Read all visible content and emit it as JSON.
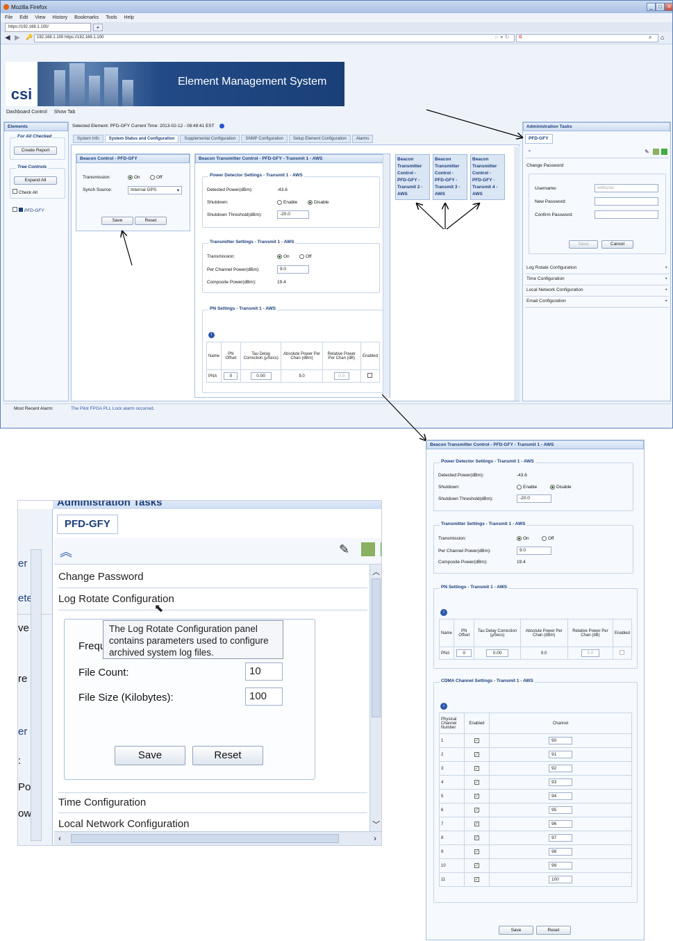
{
  "browser": {
    "title": "Mozilla Firefox",
    "menu": [
      "File",
      "Edit",
      "View",
      "History",
      "Bookmarks",
      "Tools",
      "Help"
    ],
    "tab_label": "https://192.168.1.100/",
    "new_tab": "+",
    "url": "192.168.1.100   https://192.168.1.100",
    "search_engine": "G"
  },
  "app": {
    "banner_title": "Element Management System",
    "logo": "csi",
    "toolbar": [
      "Dashboard Control",
      "Show Tab"
    ],
    "selected_element": "Selected Element:  PFD-GFY   Current Time: 2013-02-12 - 08:49:41 EST",
    "recent_alarm_label": "Most Recent Alarm:",
    "recent_alarm_text": "The Pilot FPGA PLL Lock alarm occurred."
  },
  "elements_panel": {
    "title": "Elements",
    "for_all_checked": "For All Checked",
    "create_report": "Create Report",
    "tree_controls": "Tree Controls",
    "expand_all": "Expand All",
    "check_all": "Check All",
    "node": "PFD-GFY"
  },
  "main_tabs": [
    "System Info",
    "System Status and Configuration",
    "Supplemental Configuration",
    "SNMP Configuration",
    "Setup Element Configuration",
    "Alarms"
  ],
  "beacon_control": {
    "title": "Beacon Control - PFD-GFY",
    "transmission_label": "Transmission:",
    "on": "On",
    "off": "Off",
    "synch_label": "Synch Source:",
    "synch_value": "Internal GPS",
    "save": "Save",
    "reset": "Reset"
  },
  "transmitter": {
    "title": "Beacon Transmitter Control - PFD-GFY - Transmit 1 - AWS",
    "power_section": "Power Detector Settings - Transmit 1 - AWS",
    "detected_label": "Detected Power(dBm):",
    "detected_value": "-43.6",
    "shutdown_label": "Shutdown:",
    "enable": "Enable",
    "disable": "Disable",
    "threshold_label": "Shutdown Threshold(dBm):",
    "threshold_value": "-20.0",
    "tx_section": "Transmitter Settings - Transmit 1 - AWS",
    "transmission_label": "Transmission:",
    "on": "On",
    "off": "Off",
    "per_channel_label": "Per Channel Power(dBm):",
    "per_channel_value": "9.0",
    "composite_label": "Composite Power(dBm):",
    "composite_value": "19.4",
    "pn_section": "PN Settings - Transmit 1 - AWS",
    "pn_headers": [
      "Name",
      "PN Offset",
      "Tau Delay Correction (µSecs)",
      "Absolute Power Per Chan (dBm)",
      "Relative Power Per Chan (dB)",
      "Enabled"
    ],
    "pn_row": [
      "PNA",
      "0",
      "0.00",
      "9.0",
      "0.0",
      ""
    ],
    "cdma_section": "CDMA Channel Settings - Transmit 1 - AWS",
    "cdma_headers": [
      "Physical Channel Number",
      "Enabled",
      "Channel"
    ],
    "cdma_rows": [
      [
        "1",
        "✓",
        "90"
      ],
      [
        "2",
        "✓",
        "91"
      ],
      [
        "3",
        "✓",
        "92"
      ],
      [
        "4",
        "✓",
        "93"
      ],
      [
        "5",
        "✓",
        "94"
      ],
      [
        "6",
        "✓",
        "95"
      ],
      [
        "7",
        "✓",
        "96"
      ],
      [
        "8",
        "✓",
        "97"
      ],
      [
        "9",
        "✓",
        "98"
      ],
      [
        "10",
        "✓",
        "99"
      ],
      [
        "11",
        "✓",
        "100"
      ]
    ],
    "save": "Save",
    "reset": "Reset"
  },
  "beacons": [
    "Beacon Transmitter Control - PFD-GFY - Transmit 2 - AWS",
    "Beacon Transmitter Control - PFD-GFY - Transmit 3 - AWS",
    "Beacon Transmitter Control - PFD-GFY - Transmit 4 - AWS"
  ],
  "admin": {
    "title": "Administration Tasks",
    "tab": "PFD-GFY",
    "change_password": "Change Password",
    "username_label": "Username:",
    "username_value": "webuser",
    "new_password_label": "New Password:",
    "confirm_label": "Confirm Password:",
    "save": "Save",
    "cancel": "Cancel",
    "sections": [
      "Log Rotate Configuration",
      "Time Configuration",
      "Local Network Configuration",
      "Email Configuration"
    ]
  },
  "zoom": {
    "header": "Administration Tasks",
    "tab": "PFD-GFY",
    "change_password": "Change Password",
    "log_rotate": "Log Rotate Configuration",
    "tooltip": "The Log Rotate Configuration panel contains parameters used to configure archived system log files.",
    "freq_label": "Frequ",
    "file_count_label": "File Count:",
    "file_count_value": "10",
    "file_size_label": "File Size (Kilobytes):",
    "file_size_value": "100",
    "save": "Save",
    "reset": "Reset",
    "time_config": "Time Configuration",
    "local_network": "Local Network Configuration",
    "left_frags": [
      "er",
      "ete",
      "ve",
      "re",
      "er",
      ":",
      "Po",
      "ow"
    ]
  }
}
